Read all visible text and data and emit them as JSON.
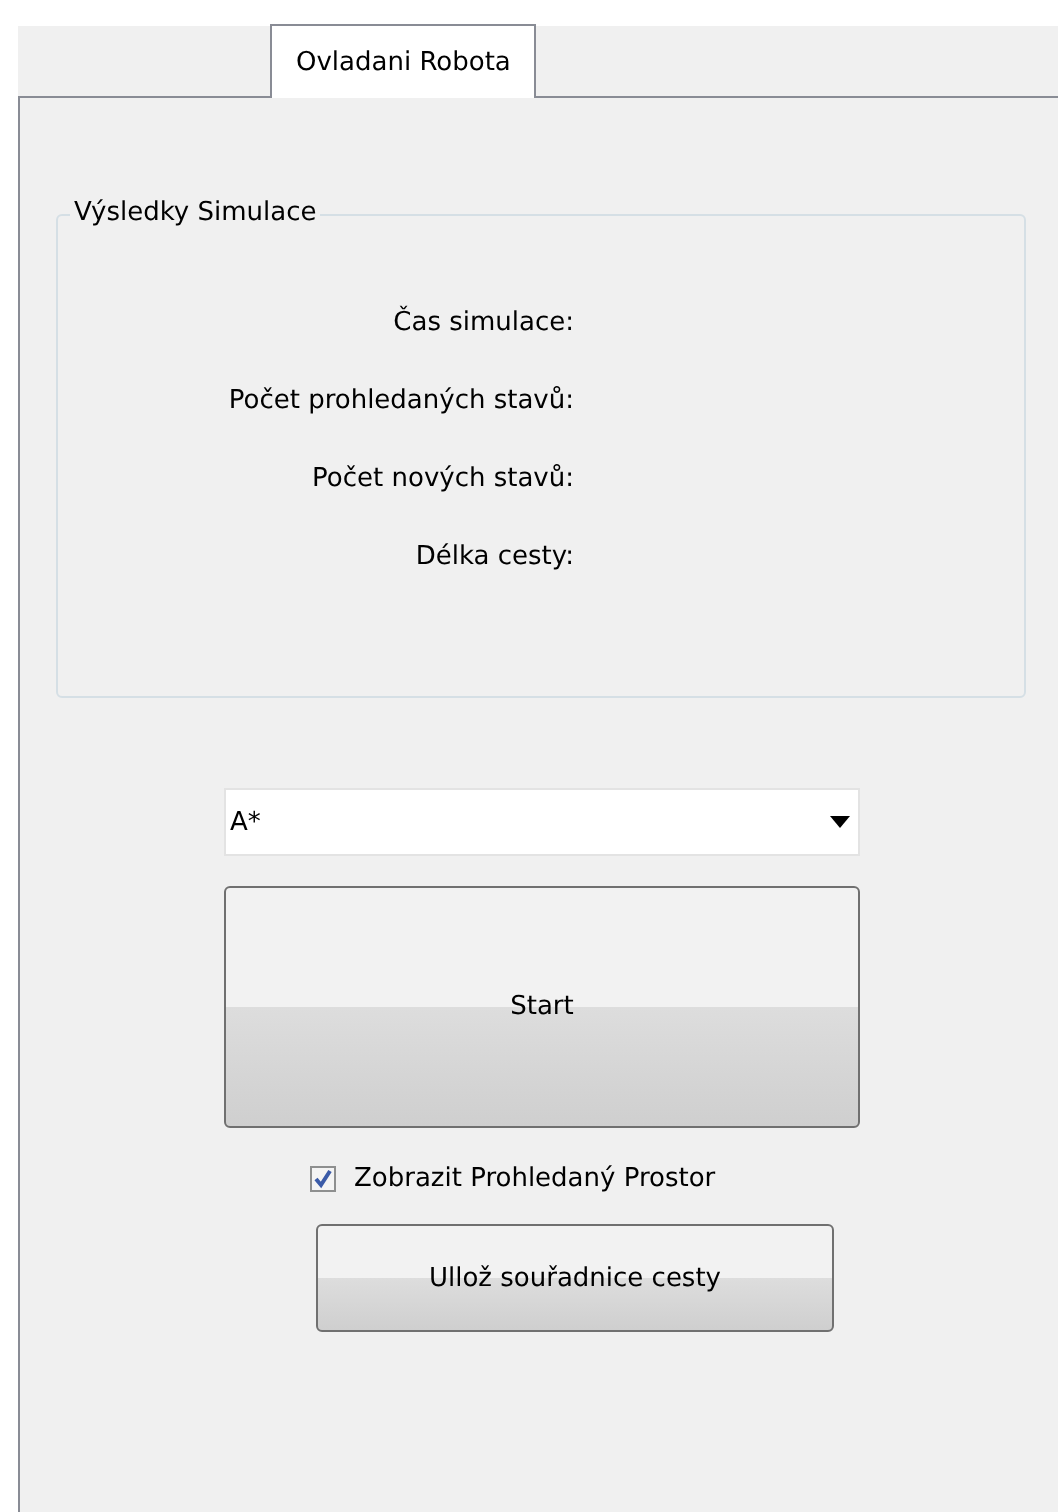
{
  "tabs": [
    {
      "label": "Ovladani Robota",
      "selected": true
    }
  ],
  "results_group": {
    "title": "Výsledky Simulace",
    "labels": [
      "Čas simulace:",
      "Počet prohledaných stavů:",
      "Počet nových stavů:",
      "Délka cesty:"
    ]
  },
  "algorithm_dropdown": {
    "value": "A*"
  },
  "start_button": {
    "label": "Start"
  },
  "show_searched_space": {
    "label": "Zobrazit Prohledaný Prostor",
    "checked": true
  },
  "save_button": {
    "label": "Ullož souřadnice cesty"
  }
}
